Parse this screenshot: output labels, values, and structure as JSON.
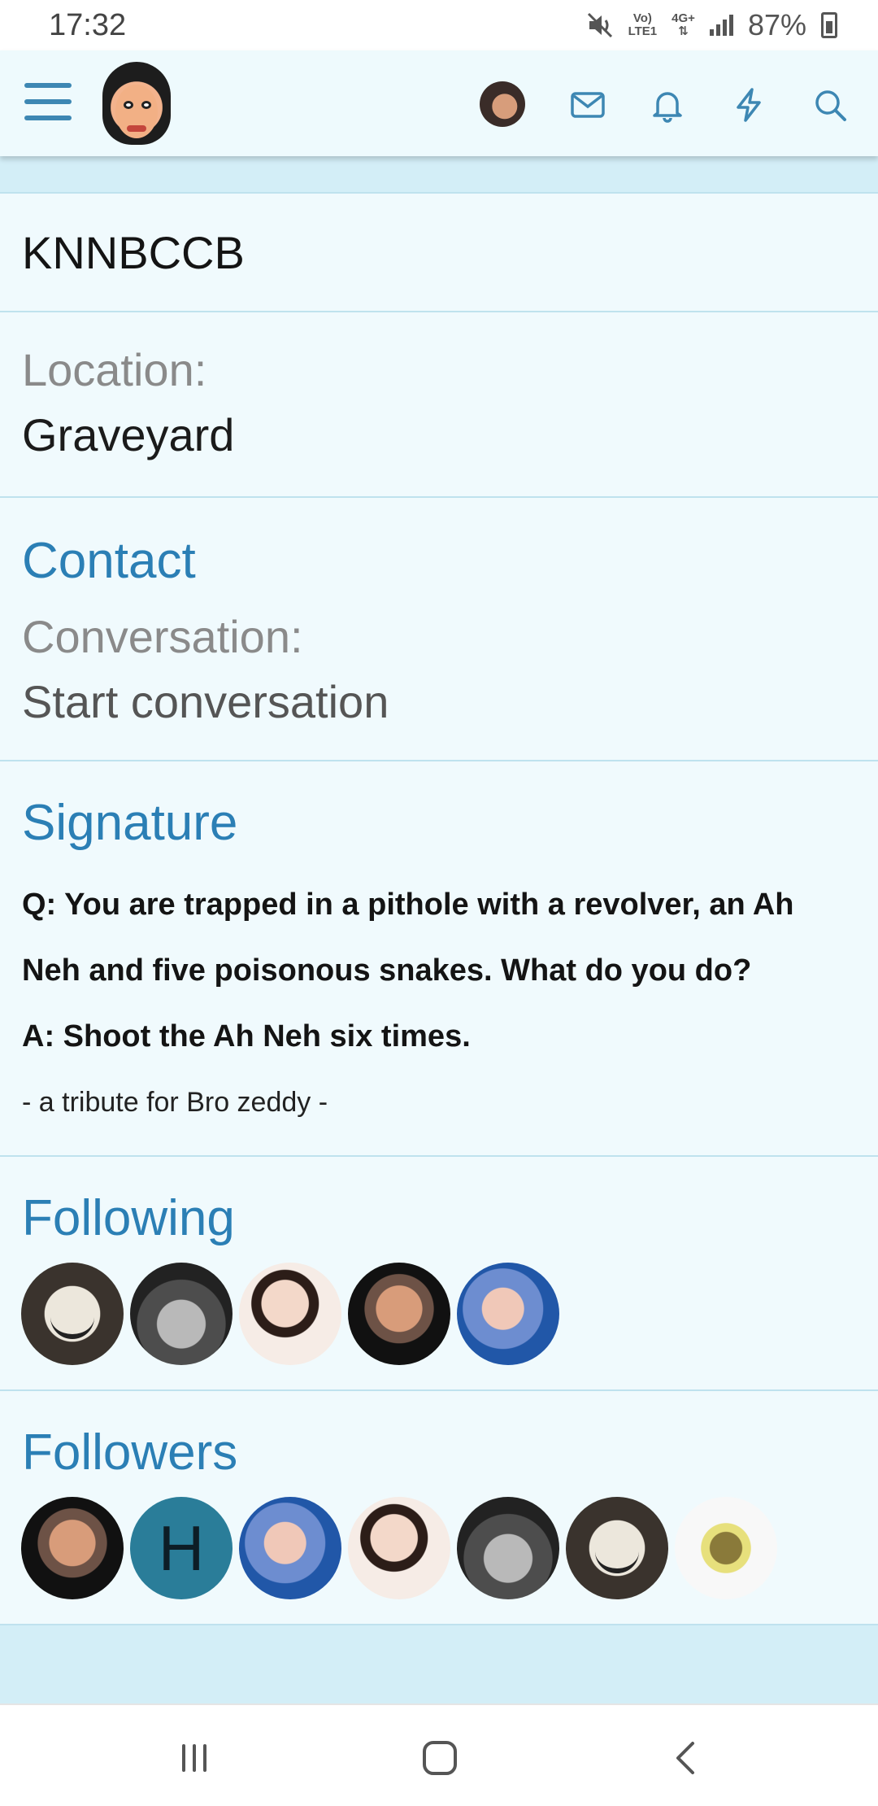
{
  "status_bar": {
    "time": "17:32",
    "network_top": "Vo)",
    "network_bottom": "LTE1",
    "net_type": "4G+",
    "battery": "87%",
    "icons": [
      "mute-icon",
      "signal-icon",
      "battery-charging-icon"
    ]
  },
  "header": {
    "icons": [
      "menu-icon",
      "site-logo",
      "user-avatar",
      "mail-icon",
      "bell-icon",
      "lightning-icon",
      "search-icon"
    ]
  },
  "profile": {
    "username": "KNNBCCB",
    "location_label": "Location:",
    "location_value": "Graveyard"
  },
  "contact": {
    "title": "Contact",
    "conversation_label": "Conversation:",
    "start_conversation": "Start conversation"
  },
  "signature": {
    "title": "Signature",
    "question": "Q: You are trapped in a pithole with a revolver, an Ah Neh and five poisonous snakes. What do you do?",
    "answer": "A: Shoot the Ah Neh six times.",
    "tribute": "- a tribute for Bro zeddy -"
  },
  "following": {
    "title": "Following",
    "avatars": [
      "mask",
      "officer",
      "girl",
      "hands",
      "pool"
    ]
  },
  "followers": {
    "title": "Followers",
    "letter_avatar": "H",
    "avatars": [
      "hands",
      "letter",
      "pool",
      "girl",
      "officer",
      "mask",
      "weed"
    ]
  },
  "colors": {
    "accent": "#2b7fb5",
    "background": "#f0fafd",
    "band": "#d3eef7",
    "icon": "#3d87b3"
  },
  "nav_bar": {
    "icons": [
      "recent-apps-icon",
      "home-icon",
      "back-icon"
    ]
  }
}
